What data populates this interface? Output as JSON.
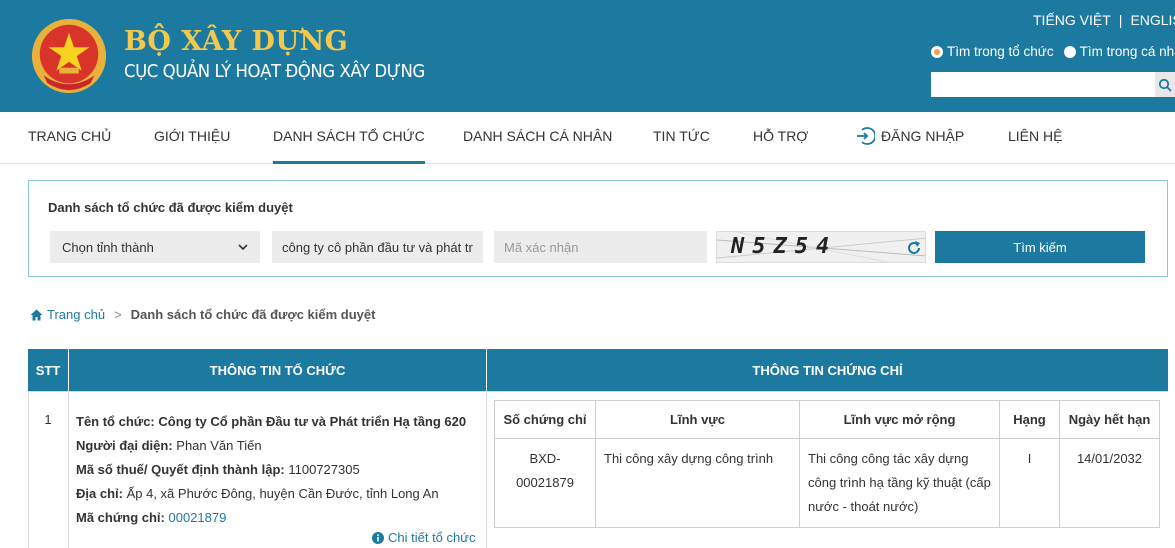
{
  "header": {
    "title": "BỘ XÂY DỰNG",
    "subtitle": "CỤC QUẢN LÝ HOẠT ĐỘNG XÂY DỰNG",
    "lang_vi": "TIẾNG VIỆT",
    "lang_sep": "|",
    "lang_en": "ENGLISH",
    "scope_org": "Tìm trong tổ chức",
    "scope_person": "Tìm trong cá nhân",
    "search_value": ""
  },
  "nav": {
    "home": "TRANG CHỦ",
    "about": "GIỚI THIỆU",
    "orgs": "DANH SÁCH TỔ CHỨC",
    "persons": "DANH SÁCH CÁ NHÂN",
    "news": "TIN TỨC",
    "support": "HỖ TRỢ",
    "login": "ĐĂNG NHẬP",
    "contact": "LIÊN HỆ",
    "active": "orgs"
  },
  "filter": {
    "title": "Danh sách tổ chức đã được kiểm duyệt",
    "province": "Chọn tỉnh thành",
    "keyword": "công ty cô phần đầu tư và phát tr",
    "captcha_placeholder": "Mã xác nhận",
    "captcha_text": "N5Z54",
    "search_button": "Tìm kiếm"
  },
  "breadcrumb": {
    "home": "Trang chủ",
    "sep": ">",
    "current": "Danh sách tổ chức đã được kiểm duyệt"
  },
  "table": {
    "col_stt": "STT",
    "col_org": "THÔNG TIN TỔ CHỨC",
    "col_cert": "THÔNG TIN CHỨNG CHỈ",
    "rows": [
      {
        "stt": "1",
        "name_label": "Tên tổ chức:",
        "name": "Công ty Cổ phần Đầu tư và Phát triển Hạ tầng 620",
        "rep_label": "Người đại diện:",
        "rep": "Phan Văn Tiến",
        "tax_label": "Mã số thuế/ Quyết định thành lập:",
        "tax": "1100727305",
        "addr_label": "Địa chỉ:",
        "addr": "Ấp 4, xã Phước Đông, huyện Cần Đước, tỉnh Long An",
        "cert_label": "Mã chứng chỉ:",
        "cert_code": "00021879",
        "detail_link": "Chi tiết tổ chức",
        "cert_headers": {
          "number": "Số chứng chỉ",
          "field": "Lĩnh vực",
          "field_ext": "Lĩnh vực mở rộng",
          "grade": "Hạng",
          "expiry": "Ngày hết hạn"
        },
        "certs": [
          {
            "number": "BXD-00021879",
            "field": "Thi công xây dựng công trình",
            "field_ext": "Thi công công tác xây dựng công trình hạ tầng kỹ thuật (cấp nước - thoát nước)",
            "grade": "I",
            "expiry": "14/01/2032"
          }
        ]
      }
    ]
  }
}
